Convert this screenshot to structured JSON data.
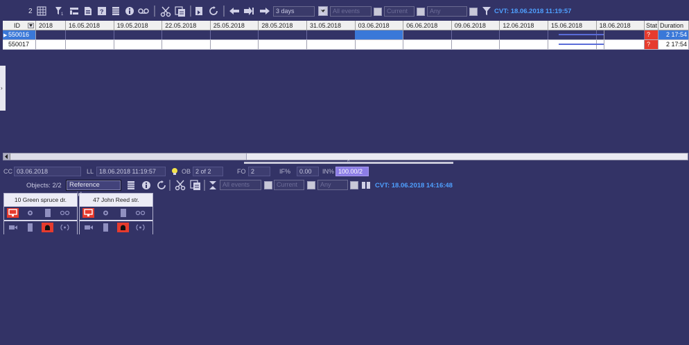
{
  "toolbar_top": {
    "count": "2",
    "period_select": "3 days",
    "events_select": "All events",
    "current_label": "Current",
    "any_label": "Any",
    "cvt": "CVT: 18.06.2018 11:19:57"
  },
  "grid": {
    "id_header": "ID",
    "first_date_partial": "2018",
    "dates": [
      "16.05.2018",
      "19.05.2018",
      "22.05.2018",
      "25.05.2018",
      "28.05.2018",
      "31.05.2018",
      "03.06.2018",
      "06.06.2018",
      "09.06.2018",
      "12.06.2018",
      "15.06.2018",
      "18.06.2018"
    ],
    "state_header": "Stat",
    "duration_header": "Duration",
    "rows": [
      {
        "id": "550016",
        "state": "?",
        "duration": "2 17:54",
        "selected": true
      },
      {
        "id": "550017",
        "state": "?",
        "duration": "2 17:54",
        "selected": false
      }
    ]
  },
  "infobar": {
    "cc_label": "CC",
    "cc_value": "03.06.2018",
    "ll_label": "LL",
    "ll_value": "18.06.2018 11:19:57",
    "ob_label": "OB",
    "ob_value": "2 of 2",
    "fo_label": "FO",
    "fo_value": "2",
    "if_label": "IF%",
    "if_value": "0.00",
    "in_label": "IN%",
    "in_value": "100.00/2"
  },
  "toolbar2": {
    "objects_label": "Objects: 2/2",
    "reference_button": "Reference guides",
    "events_select": "All events",
    "current_label": "Current",
    "any_label": "Any",
    "cvt": "CVT: 18.06.2018 14:16:48"
  },
  "objects": [
    {
      "name": "10 Green spruce dr."
    },
    {
      "name": "47 John Reed str."
    }
  ],
  "colors": {
    "background": "#333366",
    "selected_cell": "#3a78d8",
    "alarm_red": "#e63b2e",
    "accent_blue": "#4fa0ff",
    "highlight_purple": "#8c7de6"
  }
}
